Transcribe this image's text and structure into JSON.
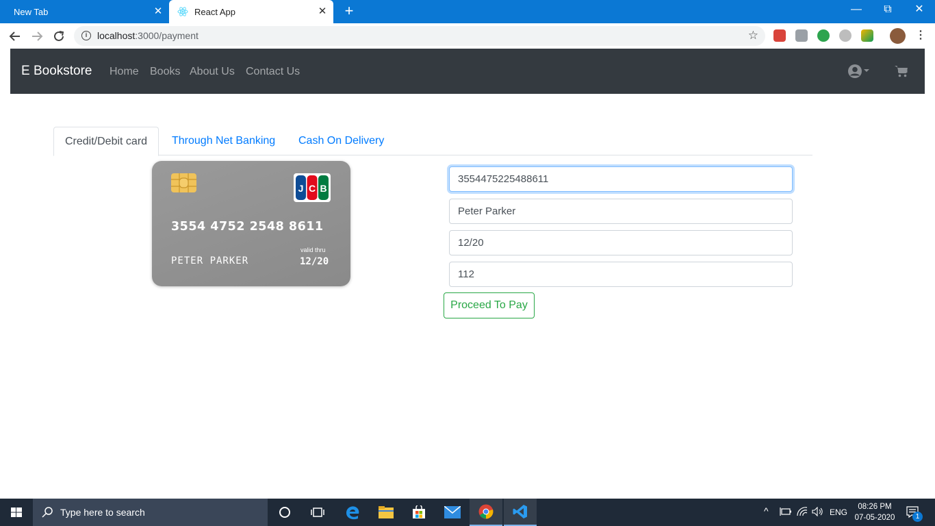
{
  "browser": {
    "tabs": [
      {
        "title": "New Tab",
        "active": false
      },
      {
        "title": "React App",
        "active": true
      }
    ],
    "url_host": "localhost",
    "url_path": ":3000/payment"
  },
  "navbar": {
    "brand": "E Bookstore",
    "links": [
      "Home",
      "Books",
      "About Us",
      "Contact Us"
    ]
  },
  "payment": {
    "tabs": [
      "Credit/Debit card",
      "Through Net Banking",
      "Cash On Delivery"
    ],
    "active_tab": "Credit/Debit card"
  },
  "card": {
    "number": "3554  4752  2548  8611",
    "name": "PETER PARKER",
    "valid_label": "valid thru",
    "expiry": "12/20",
    "brand_logo": "JCB",
    "color": "#8f8f8f"
  },
  "form": {
    "card_number": "3554475225488611",
    "name": "Peter Parker",
    "expiry": "12/20",
    "cvc": "112",
    "submit_label": "Proceed To Pay"
  },
  "taskbar": {
    "search_placeholder": "Type here to search",
    "language": "ENG",
    "time": "08:26 PM",
    "date": "07-05-2020",
    "notification_count": "1"
  },
  "colors": {
    "link": "#007bff",
    "success": "#28a745",
    "navbar_bg": "#343a40",
    "chrome_tabbar": "#0b78d4"
  }
}
